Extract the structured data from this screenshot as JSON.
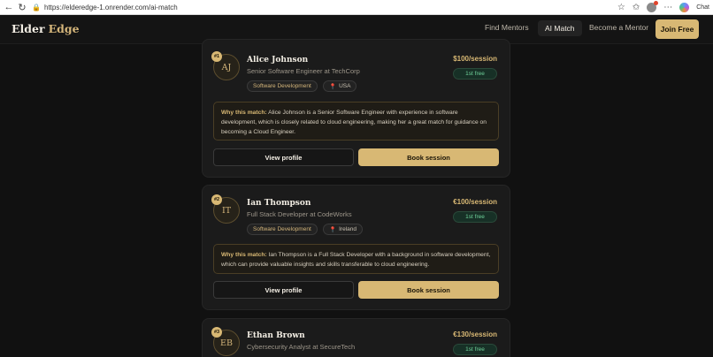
{
  "browser": {
    "url": "https://elderedge-1.onrender.com/ai-match",
    "chat_label": "Chat"
  },
  "header": {
    "logo_part1": "Elder",
    "logo_part2": "Edge",
    "nav_find": "Find Mentors",
    "nav_match": "AI Match",
    "nav_become": "Become a Mentor",
    "join": "Join Free"
  },
  "mentors": [
    {
      "rank": "#1",
      "initials": "AJ",
      "name": "Alice Johnson",
      "title": "Senior Software Engineer at TechCorp",
      "tag": "Software Development",
      "location": "USA",
      "price": "$100/session",
      "free": "1st free",
      "why_label": "Why this match:",
      "why_text": "Alice Johnson is a Senior Software Engineer with experience in software development, which is closely related to cloud engineering, making her a great match for guidance on becoming a Cloud Engineer.",
      "view": "View profile",
      "book": "Book session"
    },
    {
      "rank": "#2",
      "initials": "IT",
      "name": "Ian Thompson",
      "title": "Full Stack Developer at CodeWorks",
      "tag": "Software Development",
      "location": "Ireland",
      "price": "€100/session",
      "free": "1st free",
      "why_label": "Why this match:",
      "why_text": "Ian Thompson is a Full Stack Developer with a background in software development, which can provide valuable insights and skills transferable to cloud engineering.",
      "view": "View profile",
      "book": "Book session"
    },
    {
      "rank": "#3",
      "initials": "EB",
      "name": "Ethan Brown",
      "title": "Cybersecurity Analyst at SecureTech",
      "price": "€130/session",
      "free": "1st free"
    }
  ]
}
